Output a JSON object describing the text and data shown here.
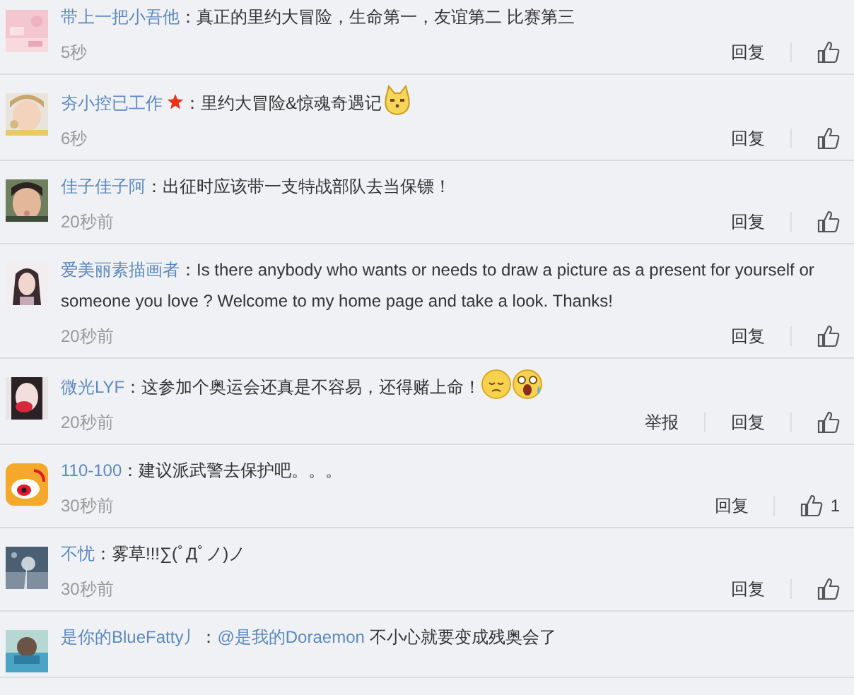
{
  "comments": [
    {
      "avatar": {
        "kind": "picture"
      },
      "name": "带上一把小吾他",
      "text": "：真正的里约大冒险，生命第一，友谊第二 比赛第三",
      "time": "5秒",
      "reply": "回复"
    },
    {
      "avatar": {
        "kind": "picture"
      },
      "name": "夯小控已工作",
      "badge": true,
      "text": "：里约大冒险&惊魂奇遇记",
      "emojis": [
        {
          "kind": "dog"
        }
      ],
      "time": "6秒",
      "reply": "回复"
    },
    {
      "avatar": {
        "kind": "picture"
      },
      "name": "佳子佳子阿",
      "text": "：出征时应该带一支特战部队去当保镖！",
      "time": "20秒前",
      "reply": "回复"
    },
    {
      "avatar": {
        "kind": "picture"
      },
      "name": "爱美丽素描画者",
      "text": "：Is there anybody who wants or needs to draw a picture as a present for yourself or someone you love ? Welcome to my home page and take a look. Thanks!",
      "time": "20秒前",
      "reply": "回复"
    },
    {
      "avatar": {
        "kind": "picture"
      },
      "name": "微光LYF",
      "text": "：这参加个奥运会还真是不容易，还得赌上命！",
      "emojis": [
        {
          "kind": "sad"
        },
        {
          "kind": "shocked"
        }
      ],
      "time": "20秒前",
      "report": "举报",
      "reply": "回复"
    },
    {
      "avatar": {
        "kind": "logo"
      },
      "name": "110-100",
      "text": "：建议派武警去保护吧。。。",
      "time": "30秒前",
      "reply": "回复",
      "likes": "1"
    },
    {
      "avatar": {
        "kind": "picture"
      },
      "name": "不忧",
      "text": "：雾草!!!∑(ﾟДﾟノ)ノ",
      "time": "30秒前",
      "reply": "回复"
    },
    {
      "avatar": {
        "kind": "picture"
      },
      "name": "是你的BlueFatty丿",
      "text": "：",
      "mention": "@是我的Doraemon",
      "after": " 不小心就要变成残奥会了"
    }
  ]
}
